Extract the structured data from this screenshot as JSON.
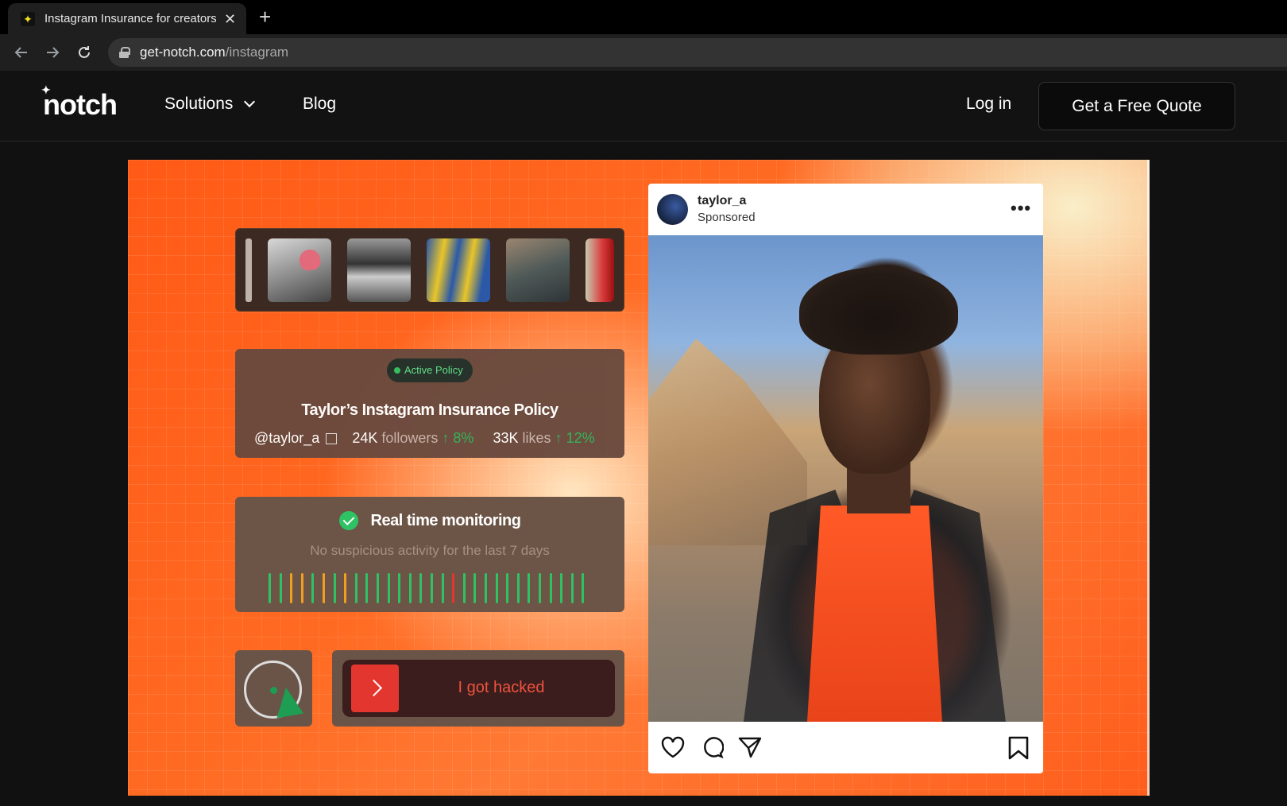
{
  "browser": {
    "tab_title": "Instagram Insurance for creators",
    "tab_favicon": "notch-star-icon",
    "url_host": "get-notch.com",
    "url_path": "/instagram"
  },
  "nav": {
    "logo": "notch",
    "solutions": "Solutions",
    "blog": "Blog",
    "login": "Log in",
    "quote": "Get a Free Quote"
  },
  "hero": {
    "badge": "Active Policy",
    "policy_title": "Taylor’s Instagram Insurance Policy",
    "handle": "@taylor_a",
    "followers_value": "24K",
    "followers_label": "followers",
    "followers_change": "↑ 8%",
    "likes_value": "33K",
    "likes_label": "likes",
    "likes_change": "↑ 12%",
    "monitoring_title": "Real time monitoring",
    "monitoring_sub": "No suspicious activity for the last 7 days",
    "activity_levels": [
      "green",
      "green",
      "orange",
      "orange",
      "green",
      "orange",
      "green",
      "orange",
      "green",
      "green",
      "green",
      "green",
      "green",
      "green",
      "green",
      "green",
      "green",
      "red",
      "green",
      "green",
      "green",
      "green",
      "green",
      "green",
      "green",
      "green",
      "green",
      "green",
      "green",
      "green"
    ],
    "hacked_label": "I got hacked"
  },
  "post": {
    "username": "taylor_a",
    "sponsored": "Sponsored",
    "more": "•••"
  },
  "colors": {
    "accent_orange": "#ff5a16",
    "status_green": "#2fc264",
    "status_orange": "#f0a020",
    "status_red": "#e3362f"
  }
}
